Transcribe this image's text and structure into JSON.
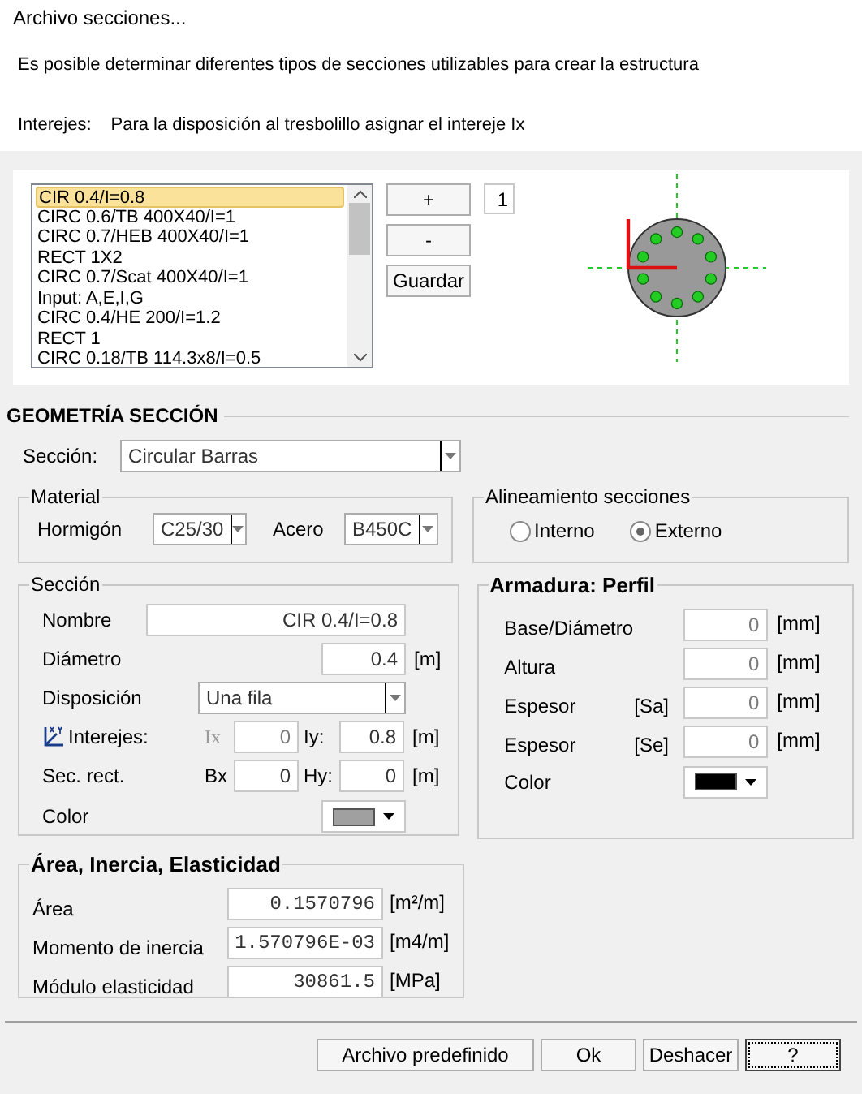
{
  "window": {
    "title": "Archivo secciones..."
  },
  "description": "Es posible determinar diferentes tipos de secciones utilizables para crear la estructura",
  "interejes_note": {
    "label": "Interejes:",
    "text": "Para la disposición al tresbolillo asignar el intereje Ix"
  },
  "sections_list": [
    {
      "label": "CIR 0.4/I=0.8",
      "selected": true
    },
    {
      "label": "CIRC 0.6/TB 400X40/I=1",
      "selected": false
    },
    {
      "label": "CIRC 0.7/HEB 400X40/I=1",
      "selected": false
    },
    {
      "label": "RECT 1X2",
      "selected": false
    },
    {
      "label": "CIRC 0.7/Scat 400X40/I=1",
      "selected": false
    },
    {
      "label": "Input: A,E,I,G",
      "selected": false
    },
    {
      "label": "CIRC 0.4/HE 200/I=1.2",
      "selected": false
    },
    {
      "label": "RECT 1",
      "selected": false
    },
    {
      "label": "CIRC 0.18/TB 114.3x8/I=0.5",
      "selected": false
    }
  ],
  "list_buttons": [
    "+",
    "-",
    "Guardar"
  ],
  "count": "1",
  "geometry": {
    "heading": "GEOMETRÍA SECCIÓN",
    "section_type": {
      "label": "Sección:",
      "value": "Circular Barras"
    }
  },
  "material": {
    "title": "Material",
    "fields": [
      {
        "label": "Hormigón",
        "value": "C25/30"
      },
      {
        "label": "Acero",
        "value": "B450C"
      }
    ]
  },
  "alignment": {
    "title": "Alineamiento secciones",
    "options": [
      {
        "label": "Interno",
        "selected": false
      },
      {
        "label": "Externo",
        "selected": true
      }
    ]
  },
  "section": {
    "title": "Sección",
    "name": {
      "label": "Nombre",
      "value": "CIR 0.4/I=0.8"
    },
    "diameter": {
      "label": "Diámetro",
      "value": "0.4",
      "unit": "[m]"
    },
    "layout": {
      "label": "Disposición",
      "value": "Una fila"
    },
    "spacing": {
      "label": "Interejes:",
      "a_label": "Ix",
      "a_disabled": true,
      "a_value": "0",
      "b_label": "Iy:",
      "b_value": "0.8",
      "unit": "[m]"
    },
    "rect": {
      "label": "Sec. rect.",
      "a_label": "Bx",
      "a_disabled": false,
      "a_value": "0",
      "b_label": "Hy:",
      "b_value": "0",
      "unit": "[m]"
    },
    "color": {
      "label": "Color",
      "color": "#a0a0a0"
    }
  },
  "reinforcement": {
    "title": "Armadura: Perfil",
    "fields": [
      {
        "label": "Base/Diámetro",
        "value": "0",
        "unit": "[mm]",
        "disabled": true
      },
      {
        "label": "Altura",
        "value": "0",
        "unit": "[mm]",
        "disabled": true
      },
      {
        "label": "Espesor",
        "tag": "[Sa]",
        "value": "0",
        "unit": "[mm]",
        "disabled": true
      },
      {
        "label": "Espesor",
        "tag": "[Se]",
        "value": "0",
        "unit": "[mm]",
        "disabled": true
      }
    ],
    "color": {
      "label": "Color",
      "color": "#000000"
    }
  },
  "properties": {
    "title": "Área, Inercia, Elasticidad",
    "fields": [
      {
        "label": "Área",
        "value": "0.1570796",
        "unit": "[m²/m]"
      },
      {
        "label": "Momento de inercia",
        "value": "1.570796E-03",
        "unit": "[m4/m]"
      },
      {
        "label": "Módulo elasticidad",
        "value": "30861.5",
        "unit": "[MPa]"
      }
    ]
  },
  "buttons": [
    {
      "label": "Archivo predefinido",
      "focused": false
    },
    {
      "label": "Ok",
      "focused": false
    },
    {
      "label": "Deshacer",
      "focused": false
    },
    {
      "label": "?",
      "focused": true
    }
  ]
}
